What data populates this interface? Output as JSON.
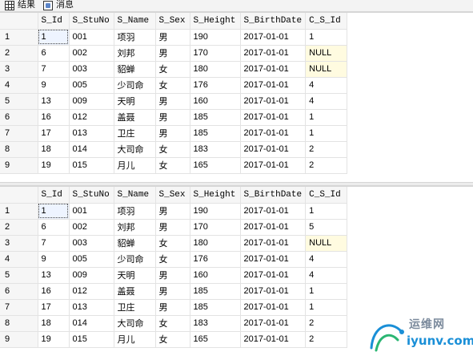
{
  "tabs": [
    {
      "label": "结果",
      "icon": "grid-icon"
    },
    {
      "label": "消息",
      "icon": "message-icon"
    }
  ],
  "grids": [
    {
      "columns": [
        "S_Id",
        "S_StuNo",
        "S_Name",
        "S_Sex",
        "S_Height",
        "S_BirthDate",
        "C_S_Id"
      ],
      "rows": [
        {
          "n": "1",
          "cells": [
            "1",
            "001",
            "项羽",
            "男",
            "190",
            "2017-01-01",
            "1"
          ]
        },
        {
          "n": "2",
          "cells": [
            "6",
            "002",
            "刘邦",
            "男",
            "170",
            "2017-01-01",
            "NULL"
          ]
        },
        {
          "n": "3",
          "cells": [
            "7",
            "003",
            "貂蝉",
            "女",
            "180",
            "2017-01-01",
            "NULL"
          ]
        },
        {
          "n": "4",
          "cells": [
            "9",
            "005",
            "少司命",
            "女",
            "176",
            "2017-01-01",
            "4"
          ]
        },
        {
          "n": "5",
          "cells": [
            "13",
            "009",
            "天明",
            "男",
            "160",
            "2017-01-01",
            "4"
          ]
        },
        {
          "n": "6",
          "cells": [
            "16",
            "012",
            "盖聂",
            "男",
            "185",
            "2017-01-01",
            "1"
          ]
        },
        {
          "n": "7",
          "cells": [
            "17",
            "013",
            "卫庄",
            "男",
            "185",
            "2017-01-01",
            "1"
          ]
        },
        {
          "n": "8",
          "cells": [
            "18",
            "014",
            "大司命",
            "女",
            "183",
            "2017-01-01",
            "2"
          ]
        },
        {
          "n": "9",
          "cells": [
            "19",
            "015",
            "月儿",
            "女",
            "165",
            "2017-01-01",
            "2"
          ]
        }
      ]
    },
    {
      "columns": [
        "S_Id",
        "S_StuNo",
        "S_Name",
        "S_Sex",
        "S_Height",
        "S_BirthDate",
        "C_S_Id"
      ],
      "rows": [
        {
          "n": "1",
          "cells": [
            "1",
            "001",
            "项羽",
            "男",
            "190",
            "2017-01-01",
            "1"
          ]
        },
        {
          "n": "2",
          "cells": [
            "6",
            "002",
            "刘邦",
            "男",
            "170",
            "2017-01-01",
            "5"
          ]
        },
        {
          "n": "3",
          "cells": [
            "7",
            "003",
            "貂蝉",
            "女",
            "180",
            "2017-01-01",
            "NULL"
          ]
        },
        {
          "n": "4",
          "cells": [
            "9",
            "005",
            "少司命",
            "女",
            "176",
            "2017-01-01",
            "4"
          ]
        },
        {
          "n": "5",
          "cells": [
            "13",
            "009",
            "天明",
            "男",
            "160",
            "2017-01-01",
            "4"
          ]
        },
        {
          "n": "6",
          "cells": [
            "16",
            "012",
            "盖聂",
            "男",
            "185",
            "2017-01-01",
            "1"
          ]
        },
        {
          "n": "7",
          "cells": [
            "17",
            "013",
            "卫庄",
            "男",
            "185",
            "2017-01-01",
            "1"
          ]
        },
        {
          "n": "8",
          "cells": [
            "18",
            "014",
            "大司命",
            "女",
            "183",
            "2017-01-01",
            "2"
          ]
        },
        {
          "n": "9",
          "cells": [
            "19",
            "015",
            "月儿",
            "女",
            "165",
            "2017-01-01",
            "2"
          ]
        }
      ]
    }
  ],
  "watermark": {
    "cn_text": "运维网",
    "en_text": "iyunv.com"
  }
}
